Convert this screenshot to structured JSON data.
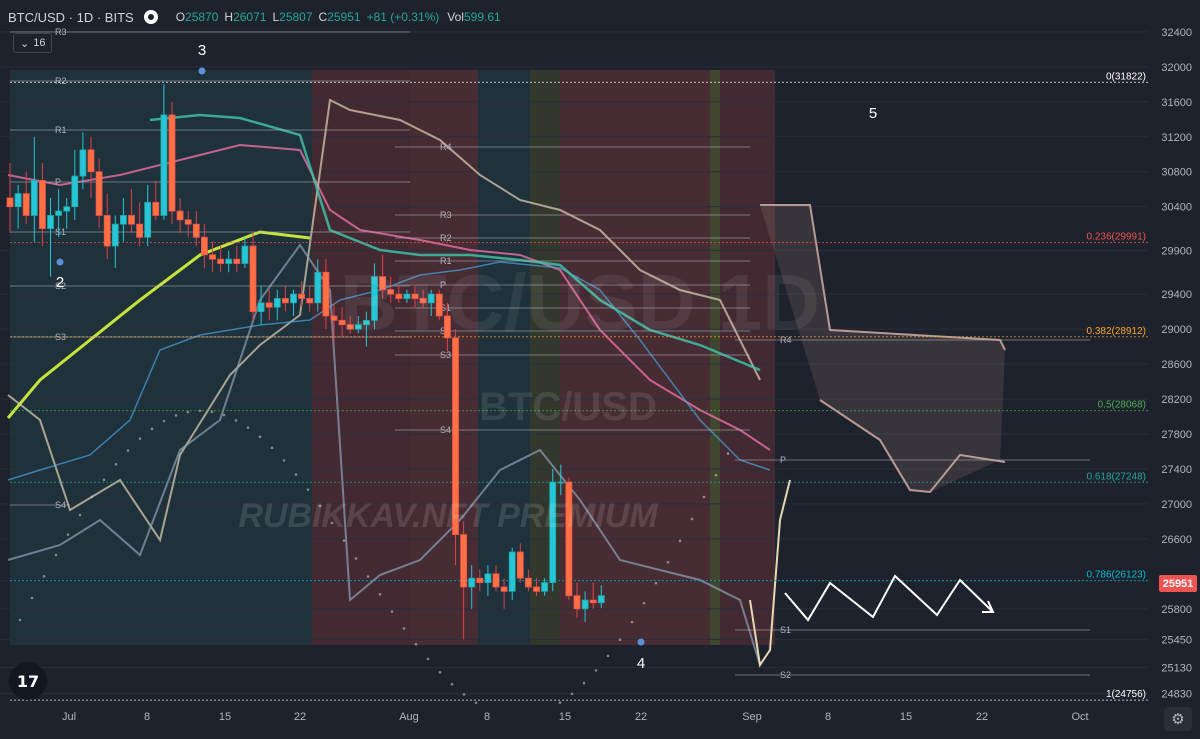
{
  "header": {
    "symbol": "BTC/USD · 1D · BITS",
    "open_key": "O",
    "open": "25870",
    "high_key": "H",
    "high": "26071",
    "low_key": "L",
    "low": "25807",
    "close_key": "C",
    "close": "25951",
    "change": "+81 (+0.31%)",
    "vol_key": "Vol",
    "vol": "599.61",
    "indicator_count": "16"
  },
  "watermark": {
    "big": "BTC/USD 1D",
    "small": "BTC/USD",
    "author": "RUBIKKAV.NFT PREMIUM"
  },
  "colors": {
    "up": "#26a69a",
    "down": "#ef5350",
    "bg": "#1e222d",
    "text": "#d1d4dc",
    "fib_236": "#ef5350",
    "fib_382": "#f7a325",
    "fib_05": "#4caf50",
    "fib_618": "#26a69a",
    "fib_786": "#00bcd4"
  },
  "last_price": "25951",
  "chart_data": {
    "type": "candlestick",
    "symbol": "BTC/USD",
    "interval": "1D",
    "y_axis_ticks": [
      24830,
      25130,
      25450,
      25800,
      26120,
      26600,
      27000,
      27400,
      27800,
      28200,
      28600,
      29000,
      29400,
      29900,
      30400,
      30800,
      31200,
      31600,
      32000,
      32400
    ],
    "y_range": [
      24700,
      32650
    ],
    "x_axis_labels": [
      "Jul",
      "8",
      "15",
      "22",
      "Aug",
      "8",
      "15",
      "22",
      "Sep",
      "8",
      "15",
      "22",
      "Oct"
    ],
    "fib_levels": [
      {
        "label": "0(31822)",
        "value": 31822
      },
      {
        "label": "0.236(29991)",
        "value": 29991
      },
      {
        "label": "0.382(28912)",
        "value": 28912
      },
      {
        "label": "0.5(28068)",
        "value": 28068
      },
      {
        "label": "0.618(27248)",
        "value": 27248
      },
      {
        "label": "0.786(26123)",
        "value": 26123
      },
      {
        "label": "1(24756)",
        "value": 24756
      }
    ],
    "wave_labels": [
      "2",
      "3",
      "4",
      "5"
    ],
    "pivot_labels": [
      "R3",
      "R2",
      "R1",
      "P",
      "S1",
      "S2",
      "S3",
      "R4",
      "R3",
      "R2",
      "R1",
      "P",
      "S1",
      "S2",
      "S3",
      "S4",
      "R4",
      "P",
      "S1",
      "S2",
      "S4"
    ],
    "candles": [
      {
        "o": 30500,
        "h": 30900,
        "l": 30100,
        "c": 30400
      },
      {
        "o": 30400,
        "h": 30650,
        "l": 30150,
        "c": 30550
      },
      {
        "o": 30550,
        "h": 30800,
        "l": 30200,
        "c": 30300
      },
      {
        "o": 30300,
        "h": 31200,
        "l": 30000,
        "c": 30700
      },
      {
        "o": 30700,
        "h": 30900,
        "l": 29950,
        "c": 30150
      },
      {
        "o": 30150,
        "h": 30500,
        "l": 29600,
        "c": 30300
      },
      {
        "o": 30300,
        "h": 30600,
        "l": 30050,
        "c": 30350
      },
      {
        "o": 30350,
        "h": 30500,
        "l": 30150,
        "c": 30400
      },
      {
        "o": 30400,
        "h": 31050,
        "l": 30250,
        "c": 30750
      },
      {
        "o": 30750,
        "h": 31250,
        "l": 30600,
        "c": 31050
      },
      {
        "o": 31050,
        "h": 31200,
        "l": 30500,
        "c": 30800
      },
      {
        "o": 30800,
        "h": 30950,
        "l": 30150,
        "c": 30300
      },
      {
        "o": 30300,
        "h": 30550,
        "l": 29800,
        "c": 29950
      },
      {
        "o": 29950,
        "h": 30300,
        "l": 29700,
        "c": 30200
      },
      {
        "o": 30200,
        "h": 30500,
        "l": 30000,
        "c": 30300
      },
      {
        "o": 30300,
        "h": 30600,
        "l": 30100,
        "c": 30200
      },
      {
        "o": 30200,
        "h": 30450,
        "l": 29950,
        "c": 30050
      },
      {
        "o": 30050,
        "h": 30650,
        "l": 29950,
        "c": 30450
      },
      {
        "o": 30450,
        "h": 30700,
        "l": 30250,
        "c": 30300
      },
      {
        "o": 30300,
        "h": 31800,
        "l": 30250,
        "c": 31450
      },
      {
        "o": 31450,
        "h": 31600,
        "l": 30200,
        "c": 30350
      },
      {
        "o": 30350,
        "h": 30500,
        "l": 30100,
        "c": 30250
      },
      {
        "o": 30250,
        "h": 30350,
        "l": 30050,
        "c": 30200
      },
      {
        "o": 30200,
        "h": 30350,
        "l": 29950,
        "c": 30050
      },
      {
        "o": 30050,
        "h": 30200,
        "l": 29700,
        "c": 29850
      },
      {
        "o": 29850,
        "h": 30000,
        "l": 29650,
        "c": 29800
      },
      {
        "o": 29800,
        "h": 29950,
        "l": 29650,
        "c": 29750
      },
      {
        "o": 29750,
        "h": 29900,
        "l": 29650,
        "c": 29800
      },
      {
        "o": 29800,
        "h": 29950,
        "l": 29650,
        "c": 29750
      },
      {
        "o": 29750,
        "h": 30050,
        "l": 29700,
        "c": 29950
      },
      {
        "o": 29950,
        "h": 30100,
        "l": 29100,
        "c": 29200
      },
      {
        "o": 29200,
        "h": 29500,
        "l": 29050,
        "c": 29300
      },
      {
        "o": 29300,
        "h": 29450,
        "l": 29100,
        "c": 29250
      },
      {
        "o": 29250,
        "h": 29450,
        "l": 29100,
        "c": 29350
      },
      {
        "o": 29350,
        "h": 29500,
        "l": 29200,
        "c": 29300
      },
      {
        "o": 29300,
        "h": 29450,
        "l": 29150,
        "c": 29400
      },
      {
        "o": 29400,
        "h": 29550,
        "l": 29250,
        "c": 29350
      },
      {
        "o": 29350,
        "h": 29500,
        "l": 29200,
        "c": 29300
      },
      {
        "o": 29300,
        "h": 29800,
        "l": 29200,
        "c": 29650
      },
      {
        "o": 29650,
        "h": 29800,
        "l": 29000,
        "c": 29150
      },
      {
        "o": 29150,
        "h": 29300,
        "l": 28850,
        "c": 29100
      },
      {
        "o": 29100,
        "h": 29250,
        "l": 28900,
        "c": 29050
      },
      {
        "o": 29050,
        "h": 29150,
        "l": 28950,
        "c": 29000
      },
      {
        "o": 29000,
        "h": 29150,
        "l": 28950,
        "c": 29050
      },
      {
        "o": 29050,
        "h": 29200,
        "l": 28800,
        "c": 29100
      },
      {
        "o": 29100,
        "h": 29750,
        "l": 29000,
        "c": 29600
      },
      {
        "o": 29600,
        "h": 29850,
        "l": 29350,
        "c": 29450
      },
      {
        "o": 29450,
        "h": 29600,
        "l": 29300,
        "c": 29400
      },
      {
        "o": 29400,
        "h": 29500,
        "l": 29300,
        "c": 29350
      },
      {
        "o": 29350,
        "h": 29450,
        "l": 29300,
        "c": 29400
      },
      {
        "o": 29400,
        "h": 29500,
        "l": 29250,
        "c": 29350
      },
      {
        "o": 29350,
        "h": 29450,
        "l": 29250,
        "c": 29300
      },
      {
        "o": 29300,
        "h": 29450,
        "l": 29150,
        "c": 29400
      },
      {
        "o": 29400,
        "h": 29450,
        "l": 29100,
        "c": 29150
      },
      {
        "o": 29150,
        "h": 29300,
        "l": 28750,
        "c": 28900
      },
      {
        "o": 28900,
        "h": 29000,
        "l": 26300,
        "c": 26650
      },
      {
        "o": 26650,
        "h": 26800,
        "l": 25450,
        "c": 26050
      },
      {
        "o": 26050,
        "h": 26300,
        "l": 25800,
        "c": 26150
      },
      {
        "o": 26150,
        "h": 26250,
        "l": 26000,
        "c": 26100
      },
      {
        "o": 26100,
        "h": 26300,
        "l": 25950,
        "c": 26200
      },
      {
        "o": 26200,
        "h": 26300,
        "l": 26000,
        "c": 26050
      },
      {
        "o": 26050,
        "h": 26150,
        "l": 25800,
        "c": 26000
      },
      {
        "o": 26000,
        "h": 26500,
        "l": 25900,
        "c": 26450
      },
      {
        "o": 26450,
        "h": 26550,
        "l": 26100,
        "c": 26150
      },
      {
        "o": 26150,
        "h": 26250,
        "l": 26000,
        "c": 26050
      },
      {
        "o": 26050,
        "h": 26150,
        "l": 25950,
        "c": 26000
      },
      {
        "o": 26000,
        "h": 26150,
        "l": 25950,
        "c": 26100
      },
      {
        "o": 26100,
        "h": 27400,
        "l": 26000,
        "c": 27250
      },
      {
        "o": 27250,
        "h": 27450,
        "l": 27100,
        "c": 27250
      },
      {
        "o": 27250,
        "h": 27300,
        "l": 25900,
        "c": 25950
      },
      {
        "o": 25950,
        "h": 26100,
        "l": 25700,
        "c": 25800
      },
      {
        "o": 25800,
        "h": 26000,
        "l": 25650,
        "c": 25900
      },
      {
        "o": 25900,
        "h": 26100,
        "l": 25800,
        "c": 25870
      },
      {
        "o": 25870,
        "h": 26071,
        "l": 25807,
        "c": 25951
      }
    ]
  }
}
